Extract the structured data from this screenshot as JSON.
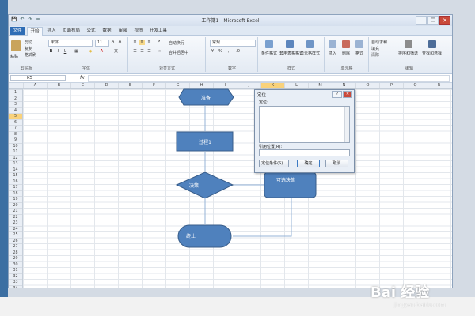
{
  "window": {
    "title": "工作簿1 - Microsoft Excel",
    "quick_access": [
      "💾",
      "↶",
      "↷",
      "="
    ],
    "controls": {
      "minimize": "–",
      "restore": "❐",
      "close": "✕"
    }
  },
  "ribbon_tabs": [
    "文件",
    "开始",
    "插入",
    "页面布局",
    "公式",
    "数据",
    "审阅",
    "视图",
    "开发工具"
  ],
  "ribbon": {
    "clipboard": {
      "paste": "粘贴",
      "cut": "剪切",
      "copy": "复制",
      "format_painter": "格式刷",
      "label": "剪贴板"
    },
    "font": {
      "name": "宋体",
      "size": "11",
      "bold": "B",
      "italic": "I",
      "underline": "U",
      "label": "字体"
    },
    "alignment": {
      "wrap": "自动换行",
      "merge": "合并后居中",
      "label": "对齐方式"
    },
    "number": {
      "format": "常规",
      "label": "数字"
    },
    "styles": {
      "conditional": "条件格式",
      "table": "套用表格格式",
      "cell": "单元格样式",
      "label": "样式"
    },
    "cells": {
      "insert": "插入",
      "delete": "删除",
      "format": "格式",
      "label": "单元格"
    },
    "editing": {
      "autosum": "自动求和",
      "fill": "填充",
      "clear": "清除",
      "sort": "排序和筛选",
      "find": "查找和选择",
      "label": "编辑"
    }
  },
  "formula_bar": {
    "name_box": "K5",
    "fx": "fx",
    "value": ""
  },
  "columns": [
    "A",
    "B",
    "C",
    "D",
    "E",
    "F",
    "G",
    "H",
    "I",
    "J",
    "K",
    "L",
    "M",
    "N",
    "O",
    "P",
    "Q",
    "R"
  ],
  "selected_column": "K",
  "rows": [
    "1",
    "2",
    "3",
    "4",
    "5",
    "6",
    "7",
    "8",
    "9",
    "10",
    "11",
    "12",
    "13",
    "14",
    "15",
    "16",
    "17",
    "18",
    "19",
    "20",
    "21",
    "22",
    "23",
    "24",
    "25",
    "26",
    "27",
    "28",
    "29",
    "30",
    "31",
    "32",
    "33",
    "34"
  ],
  "selected_row": "5",
  "flowchart": {
    "start": "准备",
    "process": "过程1",
    "decision": "决策",
    "alt_process": "可选决策",
    "terminator": "终止",
    "fill": "#4f81bd",
    "stroke": "#385d8a"
  },
  "dialog": {
    "title": "定位",
    "help": "?",
    "close": "✕",
    "goto_label": "定位:",
    "reference_label": "引用位置(R):",
    "reference_value": "",
    "special_button": "定位条件(S)...",
    "ok_button": "确定",
    "cancel_button": "取消"
  },
  "watermark": {
    "logo": "Bai 经验",
    "url": "jingyan.baidu.com"
  }
}
